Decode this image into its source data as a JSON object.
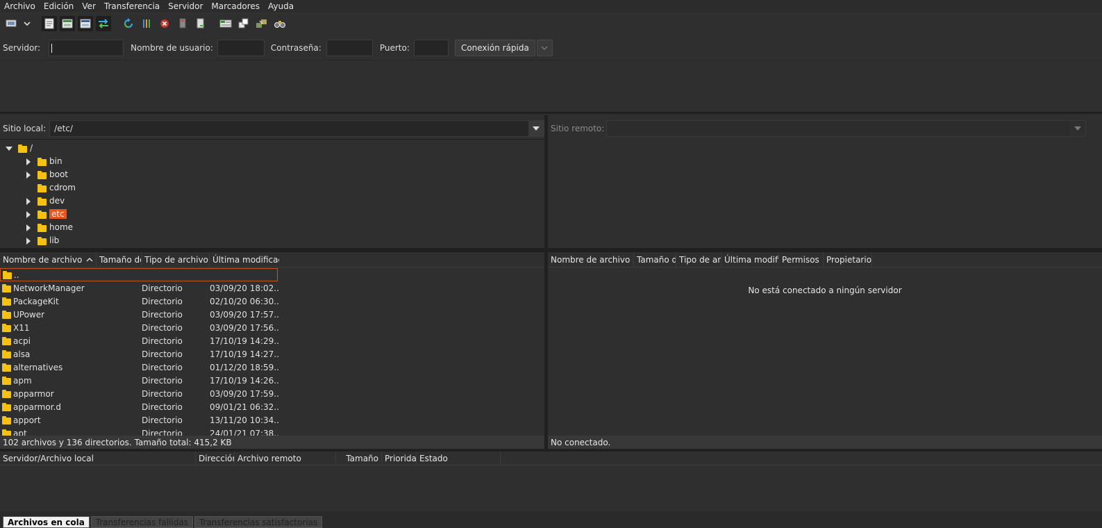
{
  "menu": [
    "Archivo",
    "Edición",
    "Ver",
    "Transferencia",
    "Servidor",
    "Marcadores",
    "Ayuda"
  ],
  "quickconnect": {
    "host_label": "Servidor:",
    "user_label": "Nombre de usuario:",
    "pass_label": "Contraseña:",
    "port_label": "Puerto:",
    "connect_label": "Conexión rápida"
  },
  "local": {
    "site_label": "Sitio local:",
    "path": "/etc/",
    "tree": [
      {
        "name": "/",
        "level": 0,
        "arrow": "down"
      },
      {
        "name": "bin",
        "level": 1,
        "arrow": "right"
      },
      {
        "name": "boot",
        "level": 1,
        "arrow": "right"
      },
      {
        "name": "cdrom",
        "level": 1,
        "arrow": ""
      },
      {
        "name": "dev",
        "level": 1,
        "arrow": "right"
      },
      {
        "name": "etc",
        "level": 1,
        "arrow": "right",
        "selected": true
      },
      {
        "name": "home",
        "level": 1,
        "arrow": "right"
      },
      {
        "name": "lib",
        "level": 1,
        "arrow": "right"
      }
    ],
    "columns": [
      "Nombre de archivo",
      "Tamaño de",
      "Tipo de archivo",
      "Última modificac"
    ],
    "rows": [
      {
        "name": "..",
        "type": "",
        "date": ""
      },
      {
        "name": "NetworkManager",
        "type": "Directorio",
        "date": "03/09/20 18:02..."
      },
      {
        "name": "PackageKit",
        "type": "Directorio",
        "date": "02/10/20 06:30..."
      },
      {
        "name": "UPower",
        "type": "Directorio",
        "date": "03/09/20 17:57..."
      },
      {
        "name": "X11",
        "type": "Directorio",
        "date": "03/09/20 17:56..."
      },
      {
        "name": "acpi",
        "type": "Directorio",
        "date": "17/10/19 14:29..."
      },
      {
        "name": "alsa",
        "type": "Directorio",
        "date": "17/10/19 14:27..."
      },
      {
        "name": "alternatives",
        "type": "Directorio",
        "date": "01/12/20 18:59..."
      },
      {
        "name": "apm",
        "type": "Directorio",
        "date": "17/10/19 14:26..."
      },
      {
        "name": "apparmor",
        "type": "Directorio",
        "date": "03/09/20 17:59..."
      },
      {
        "name": "apparmor.d",
        "type": "Directorio",
        "date": "09/01/21 06:32..."
      },
      {
        "name": "apport",
        "type": "Directorio",
        "date": "13/11/20 10:34..."
      },
      {
        "name": "apt",
        "type": "Directorio",
        "date": "24/01/21 07:38..."
      }
    ],
    "status": "102 archivos y 136 directorios. Tamaño total: 415,2 KB"
  },
  "remote": {
    "site_label": "Sitio remoto:",
    "columns": [
      "Nombre de archivo",
      "Tamaño d",
      "Tipo de arc",
      "Última modifi",
      "Permisos",
      "Propietario/"
    ],
    "empty_message": "No está conectado a ningún servidor",
    "status": "No conectado."
  },
  "queue": {
    "columns": [
      "Servidor/Archivo local",
      "Dirección",
      "Archivo remoto",
      "Tamaño",
      "Priorida",
      "Estado"
    ],
    "tabs": [
      "Archivos en cola",
      "Transferencias fallidas",
      "Transferencias satisfactorias"
    ]
  },
  "colors": {
    "accent": "#e95420",
    "folder": "#f5c211",
    "background": "#2f2f2f"
  }
}
